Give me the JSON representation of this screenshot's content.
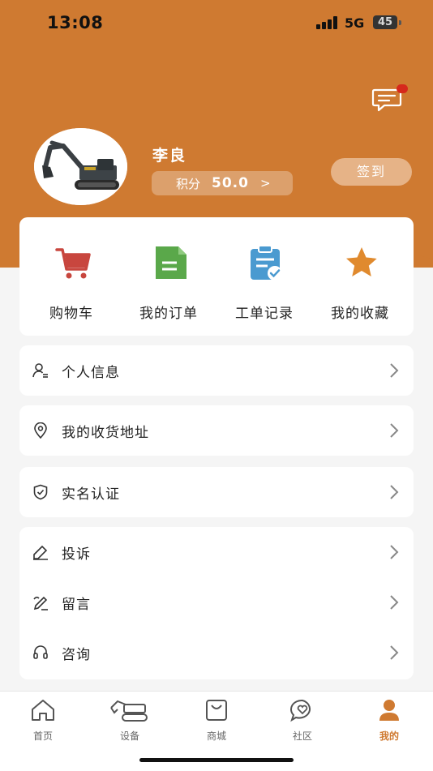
{
  "status_bar": {
    "time": "13:08",
    "network": "5G",
    "battery": "45"
  },
  "profile": {
    "name": "李良",
    "points_label": "积分",
    "points_value": "50.0",
    "points_arrow": ">",
    "signin_label": "签到"
  },
  "quick_actions": [
    {
      "label": "购物车",
      "icon": "cart-icon",
      "color": "#c8463e"
    },
    {
      "label": "我的订单",
      "icon": "order-doc-icon",
      "color": "#5aa84a"
    },
    {
      "label": "工单记录",
      "icon": "clipboard-check-icon",
      "color": "#4a9ad0"
    },
    {
      "label": "我的收藏",
      "icon": "star-icon",
      "color": "#e08a2e"
    }
  ],
  "menu": {
    "personal_info": "个人信息",
    "address": "我的收货地址",
    "real_name": "实名认证",
    "complaint": "投诉",
    "message": "留言",
    "consult": "咨询"
  },
  "tabbar": [
    {
      "label": "首页",
      "icon": "home-icon"
    },
    {
      "label": "设备",
      "icon": "excavator-icon"
    },
    {
      "label": "商城",
      "icon": "shopping-bag-icon"
    },
    {
      "label": "社区",
      "icon": "chat-heart-icon"
    },
    {
      "label": "我的",
      "icon": "user-icon",
      "active": true
    }
  ],
  "colors": {
    "brand": "#cf7a31",
    "signin_bg": "#e6b387",
    "points_bg": "#dca06c",
    "badge": "#d6281c"
  }
}
